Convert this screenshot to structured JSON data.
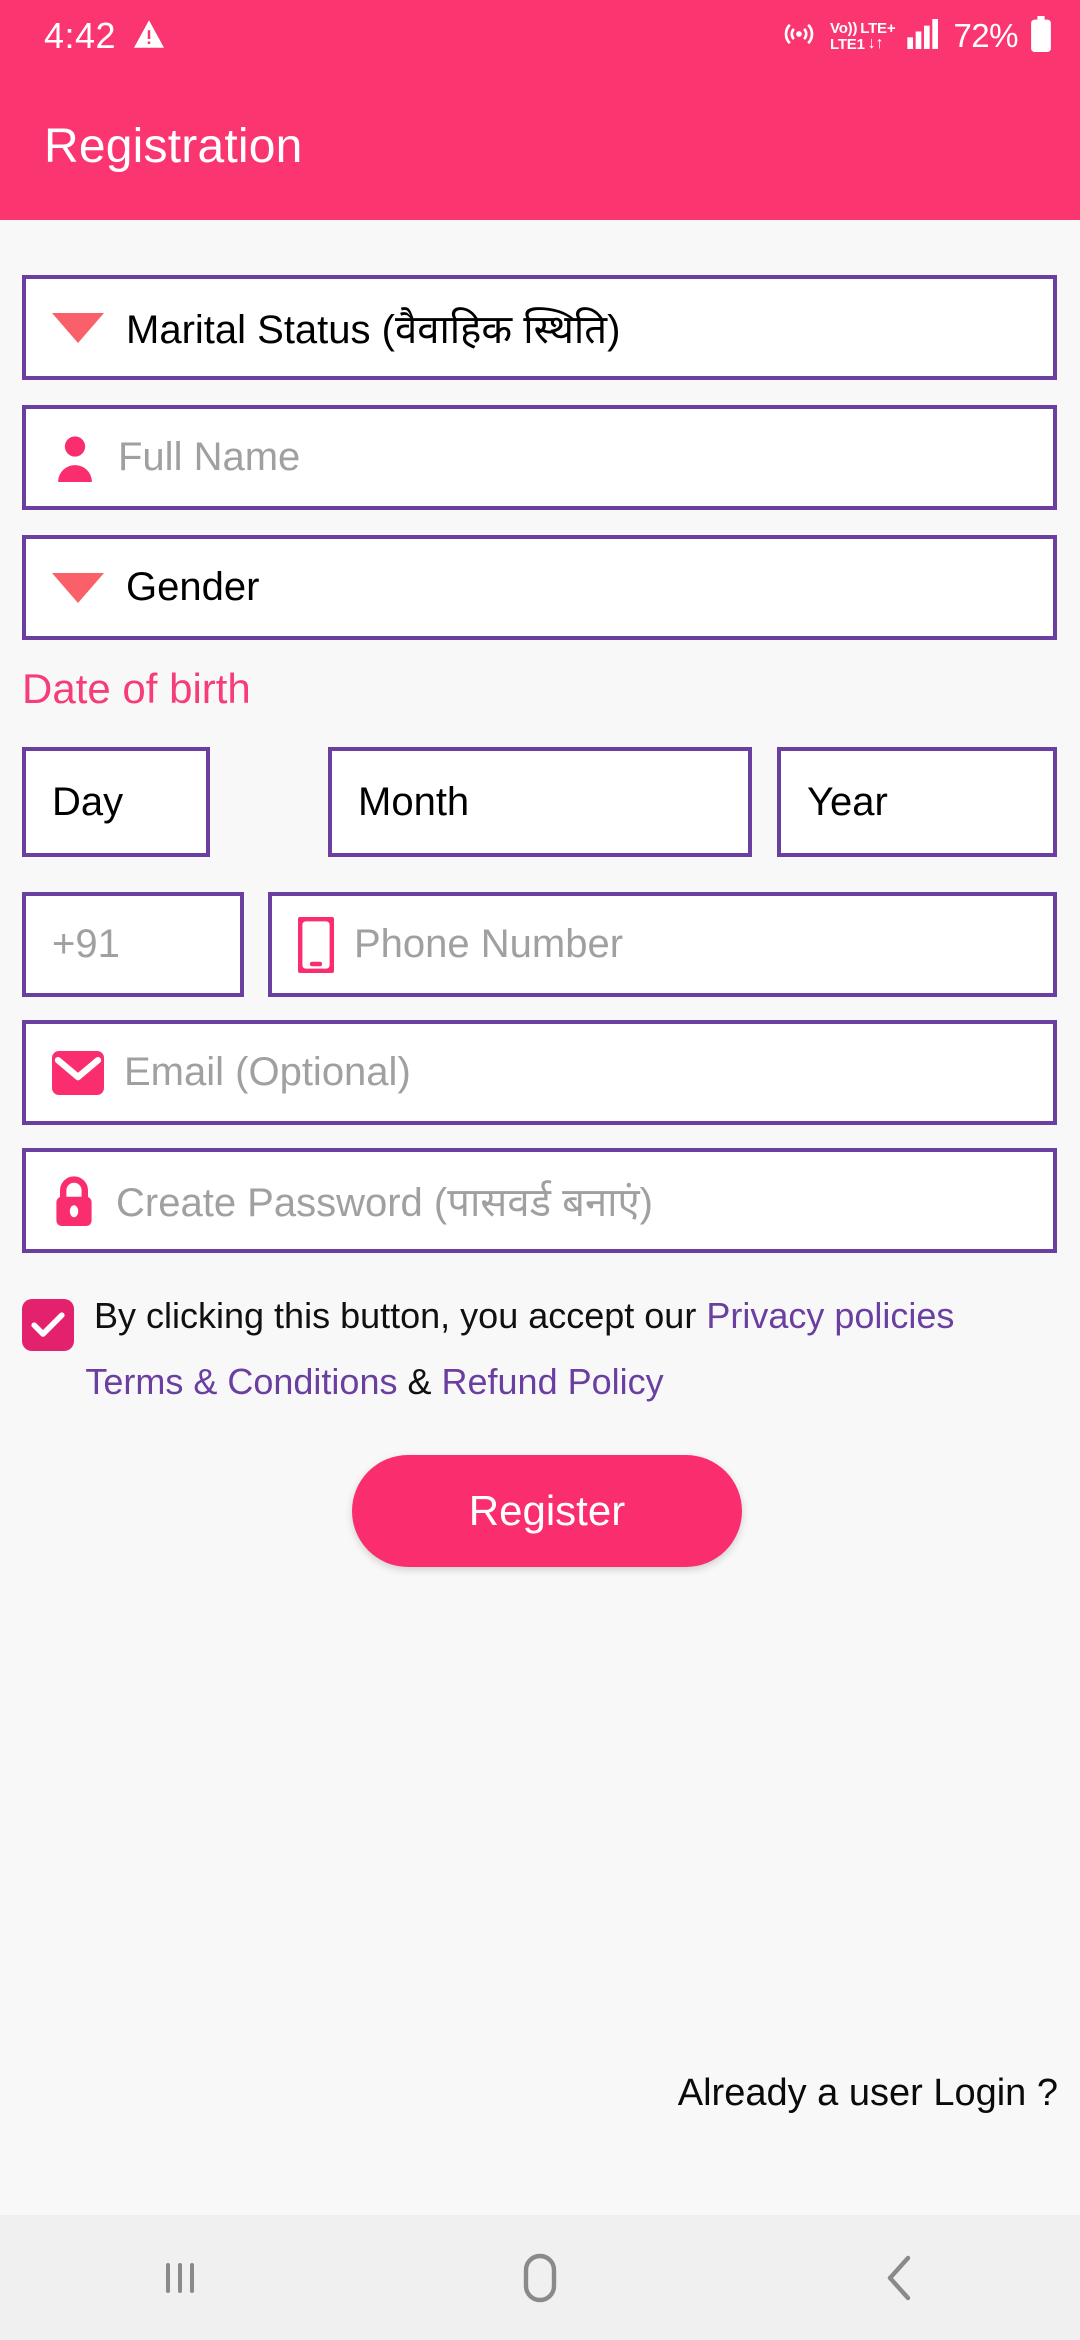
{
  "status_bar": {
    "time": "4:42",
    "warning_icon": "warning-triangle-icon",
    "hotspot_icon": "hotspot-icon",
    "volte_label": "Vo))",
    "lte_plus_label": "LTE+",
    "lte1_label": "LTE1",
    "data_arrows": "↓↑",
    "signal_icon": "signal-bars-icon",
    "battery_percent": "72%",
    "battery_icon": "battery-icon"
  },
  "app_bar": {
    "title": "Registration"
  },
  "form": {
    "marital_status": {
      "label": "Marital Status (वैवाहिक स्थिति)",
      "icon": "dropdown-triangle-icon"
    },
    "full_name": {
      "placeholder": "Full Name",
      "icon": "person-icon"
    },
    "gender": {
      "label": "Gender",
      "icon": "dropdown-triangle-icon"
    },
    "dob_label": "Date of birth",
    "day": {
      "value": "Day"
    },
    "month": {
      "value": "Month"
    },
    "year": {
      "value": "Year"
    },
    "country_code": {
      "placeholder": "+91"
    },
    "phone": {
      "placeholder": "Phone Number",
      "icon": "smartphone-icon"
    },
    "email": {
      "placeholder": "Email (Optional)",
      "icon": "envelope-icon"
    },
    "password": {
      "placeholder": "Create Password (पासवर्ड बनाएं)",
      "icon": "lock-icon"
    }
  },
  "terms": {
    "checkbox_checked": true,
    "intro": "By clicking this button, you accept our ",
    "privacy_link": "Privacy policies",
    "terms_link": "Terms & Conditions",
    "separator": " & ",
    "refund_link": "Refund Policy"
  },
  "actions": {
    "register_label": "Register",
    "login_prompt": "Already a user Login ?"
  },
  "nav_bar": {
    "recents": "recents-icon",
    "home": "home-icon",
    "back": "back-icon"
  },
  "colors": {
    "brand_pink": "#fa3570",
    "button_pink": "#fa2e6e",
    "field_border_purple": "#6b3fa0",
    "link_purple": "#6b3fa0",
    "dob_label_pink": "#f63d78",
    "triangle_red": "#f9606a",
    "checkbox_pink": "#e3216c",
    "page_bg": "#f8f8f9",
    "nav_bg": "#f0f0f0"
  }
}
